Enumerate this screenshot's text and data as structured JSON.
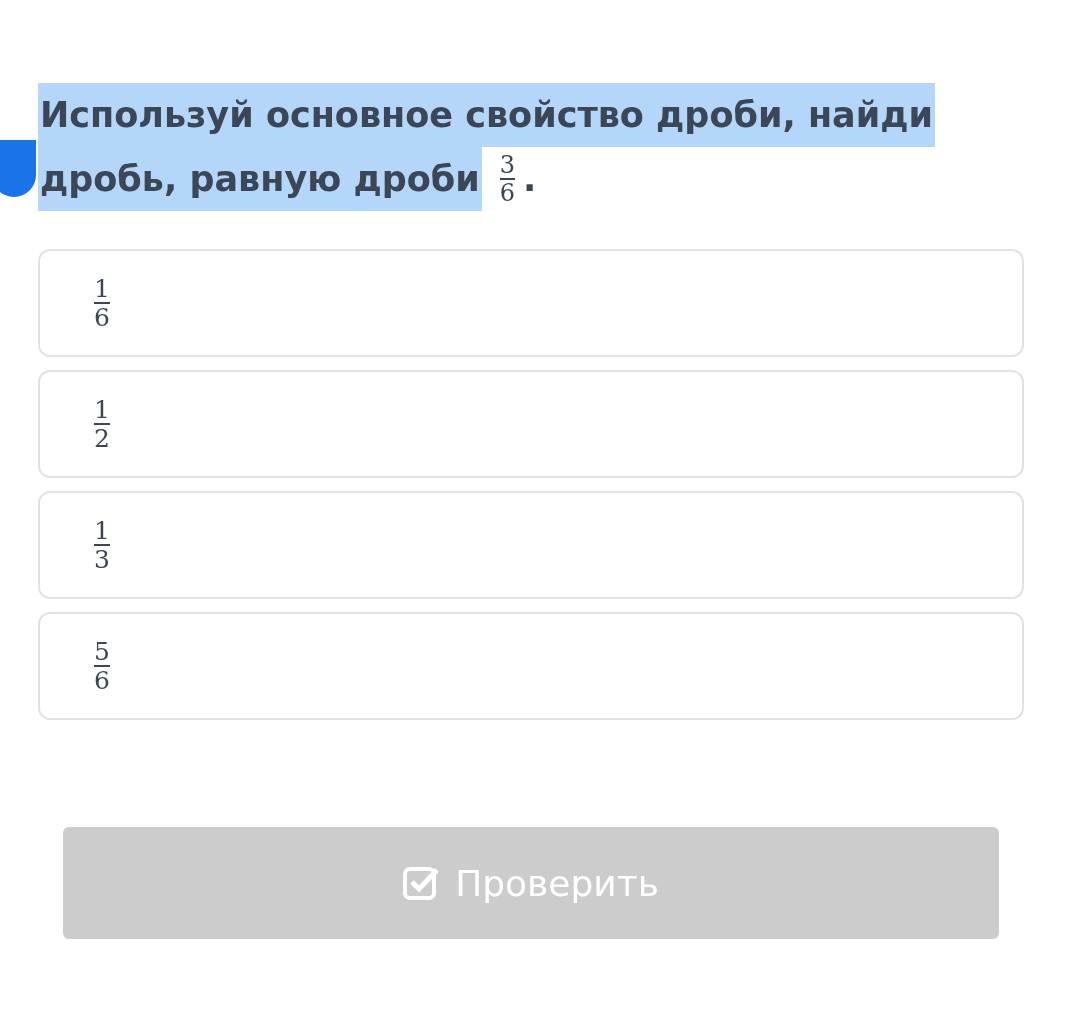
{
  "question": {
    "lines": [
      "Используй основное свойство дроби, найди",
      "дробь, равную дроби"
    ],
    "text_selected": true,
    "fraction": {
      "numerator": "3",
      "denominator": "6"
    },
    "trailing": "."
  },
  "options": [
    {
      "numerator": "1",
      "denominator": "6"
    },
    {
      "numerator": "1",
      "denominator": "2"
    },
    {
      "numerator": "1",
      "denominator": "3"
    },
    {
      "numerator": "5",
      "denominator": "6"
    }
  ],
  "check_button": {
    "label": "Проверить",
    "disabled": true
  }
}
